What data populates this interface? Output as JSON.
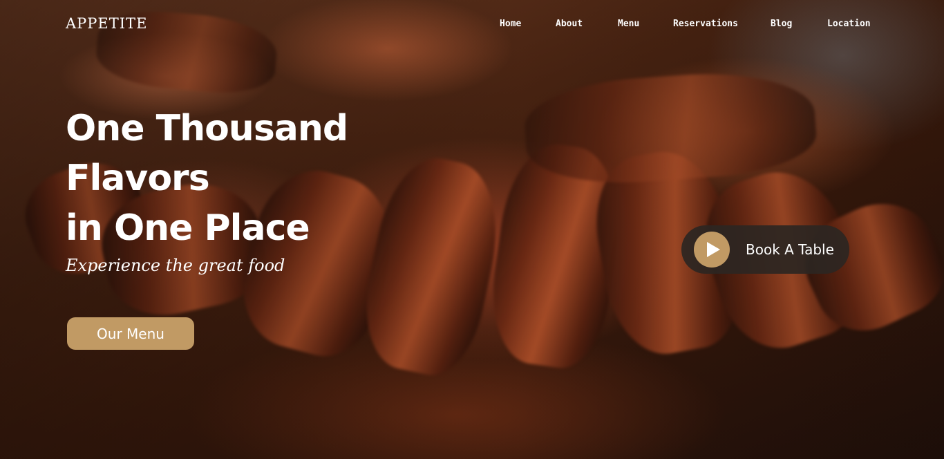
{
  "brand": {
    "name": "APPETITE"
  },
  "nav": {
    "items": [
      {
        "label": "Home"
      },
      {
        "label": "About"
      },
      {
        "label": "Menu"
      },
      {
        "label": "Reservations"
      },
      {
        "label": "Blog"
      },
      {
        "label": "Location"
      }
    ]
  },
  "hero": {
    "headline_line1": "One Thousand Flavors",
    "headline_line2": "in One Place",
    "tagline": "Experience the great food",
    "menu_button_label": "Our Menu",
    "book_button_label": "Book A Table",
    "book_button_icon": "play-icon",
    "background_image": "sliced-steak-photo"
  },
  "colors": {
    "accent": "#c19a64",
    "text": "#ffffff",
    "pill_bg": "#2d2622"
  }
}
